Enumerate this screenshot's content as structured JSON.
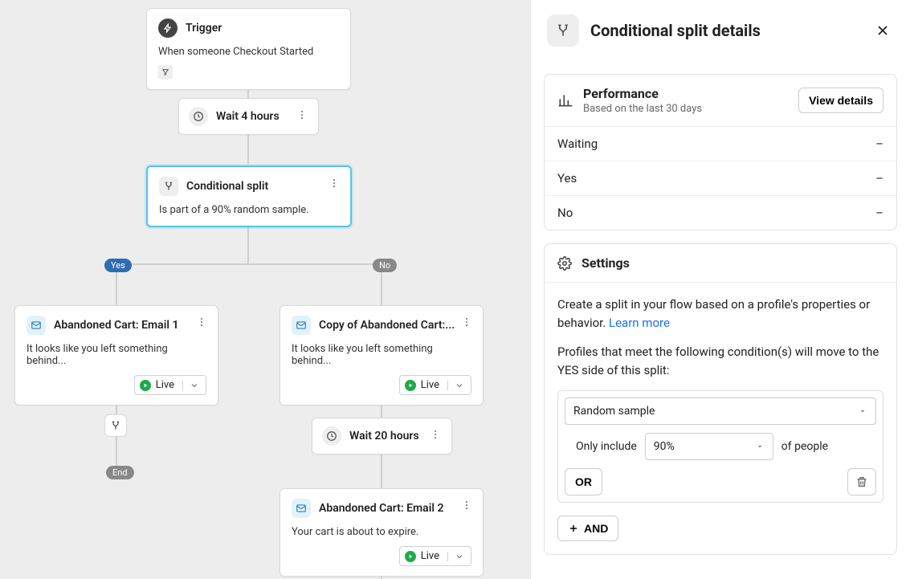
{
  "canvas": {
    "trigger": {
      "title": "Trigger",
      "desc": "When someone Checkout Started"
    },
    "wait1": {
      "label": "Wait 4 hours"
    },
    "split": {
      "title": "Conditional split",
      "desc": "Is part of a 90% random sample."
    },
    "branches": {
      "yes": "Yes",
      "no": "No",
      "end": "End"
    },
    "email1": {
      "title": "Abandoned Cart: Email 1",
      "desc": "It looks like you left something behind...",
      "status": "Live"
    },
    "email1b": {
      "title": "Copy of Abandoned Cart:...",
      "desc": "It looks like you left something behind...",
      "status": "Live"
    },
    "wait2": {
      "label": "Wait 20 hours"
    },
    "email2": {
      "title": "Abandoned Cart: Email 2",
      "desc": "Your cart is about to expire.",
      "status": "Live"
    }
  },
  "sidebar": {
    "title": "Conditional split details",
    "performance": {
      "title": "Performance",
      "subtitle": "Based on the last 30 days",
      "view_details": "View details",
      "rows": {
        "waiting": {
          "label": "Waiting",
          "value": "–"
        },
        "yes": {
          "label": "Yes",
          "value": "–"
        },
        "no": {
          "label": "No",
          "value": "–"
        }
      }
    },
    "settings": {
      "title": "Settings",
      "blurb_1": "Create a split in your flow based on a profile's properties or behavior. ",
      "learn_more": "Learn more",
      "blurb_2": "Profiles that meet the following condition(s) will move to the YES side of this split:",
      "condition_type": "Random sample",
      "only_include": "Only include",
      "percent": "90%",
      "of_people": "of people",
      "or_label": "OR",
      "and_label": "AND"
    }
  }
}
